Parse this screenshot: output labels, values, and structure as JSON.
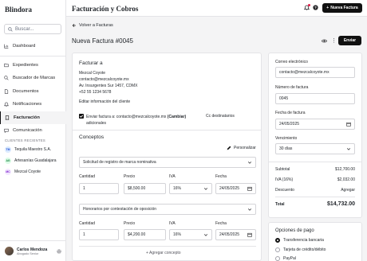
{
  "app": {
    "brand": "Blindora",
    "page_title": "Facturación y Cobros"
  },
  "search": {
    "placeholder": "Buscar..."
  },
  "sidebar": {
    "items": [
      {
        "label": "Dashboard",
        "icon": "chart-icon"
      },
      {
        "label": "Expedientes",
        "icon": "folder-icon"
      },
      {
        "label": "Buscador de Marcas",
        "icon": "search-icon"
      },
      {
        "label": "Documentos",
        "icon": "document-icon"
      },
      {
        "label": "Notificaciones",
        "icon": "bell-icon"
      },
      {
        "label": "Facturación",
        "icon": "invoice-icon"
      },
      {
        "label": "Comunicación",
        "icon": "chat-icon"
      }
    ],
    "recent_clients_title": "CLIENTES RECIENTES",
    "recent_clients": [
      {
        "initials": "TM",
        "name": "Tequila Maestro S.A.",
        "bg": "#dbeafe",
        "fg": "#1d4ed8"
      },
      {
        "initials": "AG",
        "name": "Artesanías Guadalajara",
        "bg": "#dcfce7",
        "fg": "#15803d"
      },
      {
        "initials": "MC",
        "name": "Mezcal Coyote",
        "bg": "#f3e8ff",
        "fg": "#7e22ce"
      }
    ]
  },
  "user": {
    "name": "Carlos Mendoza",
    "role": "Abogado Senior"
  },
  "topbar": {
    "new_invoice_label": "Nueva Factura"
  },
  "header": {
    "back_label": "Volver a Facturas",
    "invoice_title": "Nueva Factura #0045",
    "send_label": "Enviar"
  },
  "bill_to": {
    "title": "Facturar a",
    "name": "Mezcal Coyote",
    "email": "contacto@mezcalcoyote.mx",
    "address": "Av. Insurgentes Sur 1457, CDMX",
    "phone": "+52 55 1234 5678",
    "edit_label": "Editar información del cliente",
    "send_to_prefix": "Enviar factura a: contacto@mezcalcoyote.mx",
    "change_label": "(Cambiar)",
    "send_to_suffix": "adicionales",
    "cc_label": "Cc destinatarios"
  },
  "concepts": {
    "title": "Conceptos",
    "customize_label": "Personalizar",
    "headers": {
      "qty": "Cantidad",
      "price": "Precio",
      "tax": "IVA",
      "date": "Fecha"
    },
    "items": [
      {
        "service": "Solicitud de registro de marca nominativa",
        "qty": "1",
        "price": "$8,500.00",
        "tax": "16%",
        "date": "24/05/2025"
      },
      {
        "service": "Honorarios por contestación de oposición",
        "qty": "1",
        "price": "$4,200.00",
        "tax": "16%",
        "date": "24/05/2025"
      }
    ],
    "add_label": "Agregar concepto"
  },
  "details": {
    "email_label": "Correo electrónico",
    "email_value": "contacto@mezcalcoyote.mx",
    "number_label": "Número de factura",
    "number_value": "0045",
    "date_label": "Fecha de factura",
    "date_value": "24/05/2025",
    "due_label": "Vencimiento",
    "due_value": "30 días"
  },
  "totals": {
    "subtotal_label": "Subtotal",
    "subtotal": "$12,700.00",
    "tax_label": "IVA (16%)",
    "tax": "$2,032.00",
    "discount_label": "Descuento",
    "discount_action": "Agregar",
    "total_label": "Total",
    "total": "$14,732.00"
  },
  "payment": {
    "title": "Opciones de pago",
    "options": [
      {
        "label": "Transferencia bancaria",
        "selected": true
      },
      {
        "label": "Tarjeta de crédito/débito",
        "selected": false
      },
      {
        "label": "PayPal",
        "selected": false
      }
    ]
  }
}
